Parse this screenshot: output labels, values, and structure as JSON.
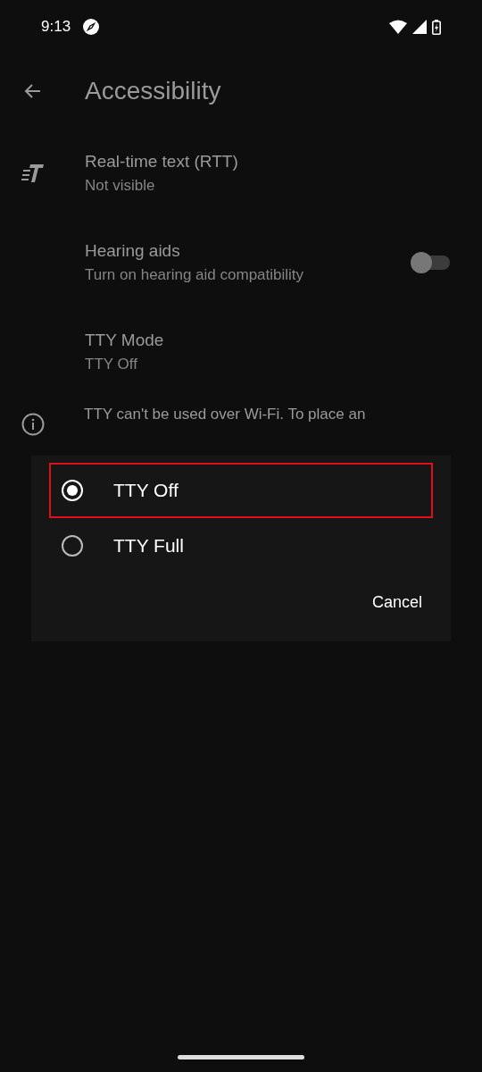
{
  "status_bar": {
    "time": "9:13"
  },
  "header": {
    "title": "Accessibility"
  },
  "settings": [
    {
      "kind": "rtt",
      "title": "Real-time text (RTT)",
      "summary": "Not visible"
    },
    {
      "kind": "toggle",
      "title": "Hearing aids",
      "summary": "Turn on hearing aid compatibility",
      "on": false
    },
    {
      "kind": "plain",
      "title": "TTY Mode",
      "summary": "TTY Off"
    }
  ],
  "info": {
    "text": "TTY can't be used over Wi-Fi. To place an"
  },
  "dialog": {
    "options": [
      {
        "label": "TTY Off",
        "selected": true,
        "highlighted": true
      },
      {
        "label": "TTY Full",
        "selected": false,
        "highlighted": false
      }
    ],
    "cancel": "Cancel"
  }
}
